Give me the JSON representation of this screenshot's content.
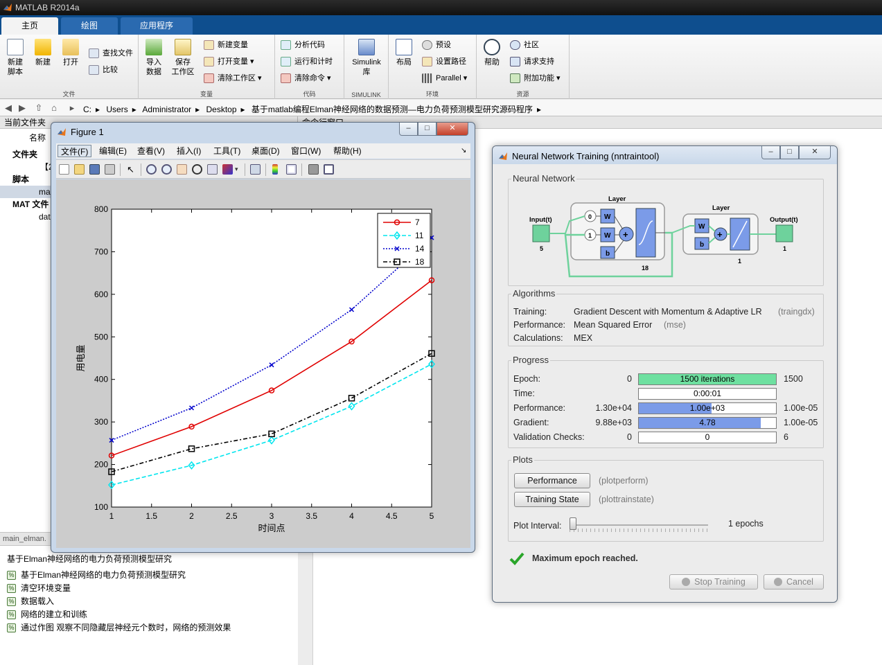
{
  "matlab": {
    "title": "MATLAB R2014a",
    "tabs": [
      "主页",
      "绘图",
      "应用程序"
    ],
    "ribbon": {
      "file": {
        "label": "文件",
        "new_script": "新建\n脚本",
        "new": "新建",
        "open": "打开",
        "find_files": "查找文件",
        "compare": "比较"
      },
      "variable": {
        "label": "变量",
        "import": "导入\n数据",
        "save_ws": "保存\n工作区",
        "new_var": "新建变量",
        "open_var": "打开变量",
        "clear_ws": "清除工作区"
      },
      "code": {
        "label": "代码",
        "analyze": "分析代码",
        "run_time": "运行和计时",
        "clear_cmd": "清除命令"
      },
      "simulink": {
        "label": "SIMULINK",
        "lib": "Simulink\n库"
      },
      "env": {
        "label": "环境",
        "layout": "布局",
        "prefs": "预设",
        "set_path": "设置路径",
        "parallel": "Parallel"
      },
      "resources": {
        "label": "资源",
        "help": "帮助",
        "community": "社区",
        "support": "请求支持",
        "addons": "附加功能"
      }
    },
    "path": [
      "C:",
      "Users",
      "Administrator",
      "Desktop",
      "基于matlab编程Elman神经网络的数据预测—电力负荷预测模型研究源码程序"
    ],
    "current_folder": {
      "title": "当前文件夹",
      "name_col": "名称",
      "groups": {
        "folder": "文件夹",
        "script": "脚本",
        "mat": "MAT 文件"
      },
      "items": {
        "folder1": "【2",
        "script1": "ma",
        "mat1": "dat"
      }
    },
    "command_window_title": "命令行窗口",
    "details": {
      "file": "main_elman.",
      "title": "基于Elman神经网络的电力负荷预测模型研究",
      "cells": [
        "基于Elman神经网络的电力负荷预测模型研究",
        "清空环境变量",
        "数据载入",
        "网络的建立和训练",
        "通过作图 观察不同隐藏层神经元个数时，网络的预测效果"
      ]
    }
  },
  "figure": {
    "title": "Figure 1",
    "menus": [
      "文件(F)",
      "编辑(E)",
      "查看(V)",
      "插入(I)",
      "工具(T)",
      "桌面(D)",
      "窗口(W)",
      "帮助(H)"
    ]
  },
  "chart_data": {
    "type": "line",
    "title": "",
    "xlabel": "时间点",
    "ylabel": "用电量",
    "xlim": [
      1,
      5
    ],
    "ylim": [
      100,
      800
    ],
    "xticks": [
      1,
      1.5,
      2,
      2.5,
      3,
      3.5,
      4,
      4.5,
      5
    ],
    "xtick_labels": [
      "1",
      "1.5",
      "2",
      "2.5",
      "3",
      "3.5",
      "4",
      "4.5",
      "5"
    ],
    "yticks": [
      100,
      200,
      300,
      400,
      500,
      600,
      700,
      800
    ],
    "ytick_labels": [
      "100",
      "200",
      "300",
      "400",
      "500",
      "600",
      "700",
      "800"
    ],
    "x": [
      1,
      2,
      3,
      4,
      5
    ],
    "legend_position": "top-right",
    "series": [
      {
        "name": "7",
        "values": [
          221,
          289,
          374,
          489,
          633
        ],
        "color": "#e00000",
        "dash": "",
        "marker": "circle"
      },
      {
        "name": "11",
        "values": [
          152,
          198,
          257,
          337,
          436
        ],
        "color": "#00e5ee",
        "dash": "6,3",
        "marker": "diamond"
      },
      {
        "name": "14",
        "values": [
          257,
          333,
          434,
          564,
          733
        ],
        "color": "#0000cc",
        "dash": "2,2",
        "marker": "x"
      },
      {
        "name": "18",
        "values": [
          183,
          237,
          272,
          356,
          461
        ],
        "color": "#000000",
        "dash": "6,3,2,3",
        "marker": "square"
      }
    ]
  },
  "nntool": {
    "title": "Neural Network Training (nntraintool)",
    "network": {
      "group": "Neural Network",
      "input_label": "Input(t)",
      "input_size": "5",
      "layer_title": "Layer",
      "hidden_size": "18",
      "output_layer_size": "1",
      "output_label": "Output(t)",
      "output_size": "1",
      "delay0": "0",
      "delay1": "1",
      "w": "W",
      "b": "b",
      "plus": "+"
    },
    "algorithms": {
      "group": "Algorithms",
      "training_label": "Training:",
      "training": "Gradient Descent with Momentum & Adaptive LR",
      "training_fn": "(traingdx)",
      "performance_label": "Performance:",
      "performance": "Mean Squared Error",
      "performance_fn": "(mse)",
      "calculations_label": "Calculations:",
      "calculations": "MEX"
    },
    "progress": {
      "group": "Progress",
      "rows": [
        {
          "label": "Epoch:",
          "start": "0",
          "value": "1500 iterations",
          "end": "1500",
          "fill": 1.0,
          "color": "#6ee0a0"
        },
        {
          "label": "Time:",
          "start": "",
          "value": "0:00:01",
          "end": "",
          "fill": 0,
          "color": "#ffffff"
        },
        {
          "label": "Performance:",
          "start": "1.30e+04",
          "value": "1.00e+03",
          "end": "1.00e-05",
          "fill": 0.53,
          "color": "#7b9be8"
        },
        {
          "label": "Gradient:",
          "start": "9.88e+03",
          "value": "4.78",
          "end": "1.00e-05",
          "fill": 0.89,
          "color": "#7b9be8"
        },
        {
          "label": "Validation Checks:",
          "start": "0",
          "value": "0",
          "end": "6",
          "fill": 0,
          "color": "#ffffff"
        }
      ]
    },
    "plots": {
      "group": "Plots",
      "perf_btn": "Performance",
      "perf_fn": "(plotperform)",
      "train_btn": "Training State",
      "train_fn": "(plottrainstate)",
      "interval_label": "Plot Interval:",
      "interval_value": "1 epochs"
    },
    "status": "Maximum epoch reached.",
    "stop_btn": "Stop Training",
    "cancel_btn": "Cancel"
  }
}
